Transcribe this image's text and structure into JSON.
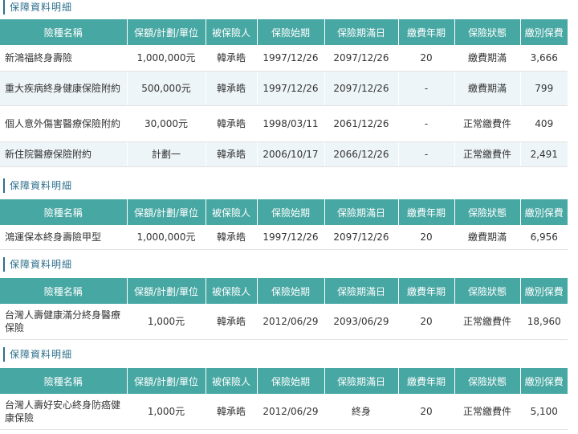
{
  "headers": [
    "險種名稱",
    "保額/計劃/單位",
    "被保險人",
    "保險始期",
    "保險期滿日",
    "繳費年期",
    "保險狀態",
    "繳別保費"
  ],
  "sections": [
    {
      "title": "保障資料明細",
      "rows": [
        [
          "新鴻福終身壽險",
          "1,000,000元",
          "韓承皓",
          "1997/12/26",
          "2097/12/26",
          "20",
          "繳費期滿",
          "3,666"
        ],
        [
          "重大疾病終身健康保險附約",
          "500,000元",
          "韓承皓",
          "1997/12/26",
          "2097/12/26",
          "-",
          "繳費期滿",
          "799"
        ],
        [
          "個人意外傷害醫療保險附約",
          "30,000元",
          "韓承皓",
          "1998/03/11",
          "2061/12/26",
          "-",
          "正常繳費件",
          "409"
        ],
        [
          "新住院醫療保險附約",
          "計劃一",
          "韓承皓",
          "2006/10/17",
          "2066/12/26",
          "-",
          "正常繳費件",
          "2,491"
        ]
      ]
    },
    {
      "title": "保障資料明細",
      "rows": [
        [
          "鴻運保本終身壽險甲型",
          "1,000,000元",
          "韓承皓",
          "1997/12/26",
          "2097/12/26",
          "20",
          "繳費期滿",
          "6,956"
        ]
      ]
    },
    {
      "title": "保障資料明細",
      "rows": [
        [
          "台灣人壽健康滿分終身醫療保險",
          "1,000元",
          "韓承皓",
          "2012/06/29",
          "2093/06/29",
          "20",
          "正常繳費件",
          "18,960"
        ]
      ]
    },
    {
      "title": "保障資料明細",
      "rows": [
        [
          "台灣人壽好安心終身防癌健康保險",
          "1,000元",
          "韓承皓",
          "2012/06/29",
          "終身",
          "20",
          "正常繳費件",
          "5,100"
        ]
      ]
    }
  ]
}
